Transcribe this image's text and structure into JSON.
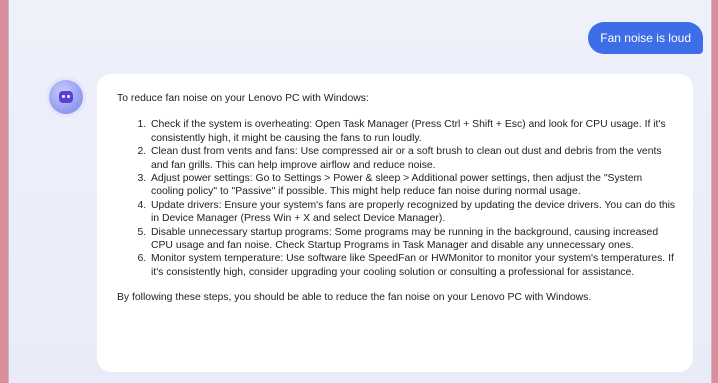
{
  "user_message": "Fan noise is loud",
  "assistant": {
    "intro": "To reduce fan noise on your Lenovo PC with Windows:",
    "steps": [
      "Check if the system is overheating: Open Task Manager (Press Ctrl + Shift + Esc) and look for CPU usage. If it's consistently high, it might be causing the fans to run loudly.",
      "Clean dust from vents and fans: Use compressed air or a soft brush to clean out dust and debris from the vents and fan grills. This can help improve airflow and reduce noise.",
      "Adjust power settings: Go to Settings > Power & sleep > Additional power settings, then adjust the \"System cooling policy\" to \"Passive\" if possible. This might help reduce fan noise during normal usage.",
      "Update drivers: Ensure your system's fans are properly recognized by updating the device drivers. You can do this in Device Manager (Press Win + X and select Device Manager).",
      "Disable unnecessary startup programs: Some programs may be running in the background, causing increased CPU usage and fan noise. Check Startup Programs in Task Manager and disable any unnecessary ones.",
      "Monitor system temperature: Use software like SpeedFan or HWMonitor to monitor your system's temperatures. If it's consistently high, consider upgrading your cooling solution or consulting a professional for assistance."
    ],
    "outro": "By following these steps, you should be able to reduce the fan noise on your Lenovo PC with Windows."
  },
  "colors": {
    "background": "#d98f9a",
    "chat_background": "#eef0fa",
    "user_bubble": "#3d6ee8",
    "assistant_card": "#ffffff"
  },
  "icons": {
    "avatar": "ai-assistant-avatar-icon"
  }
}
